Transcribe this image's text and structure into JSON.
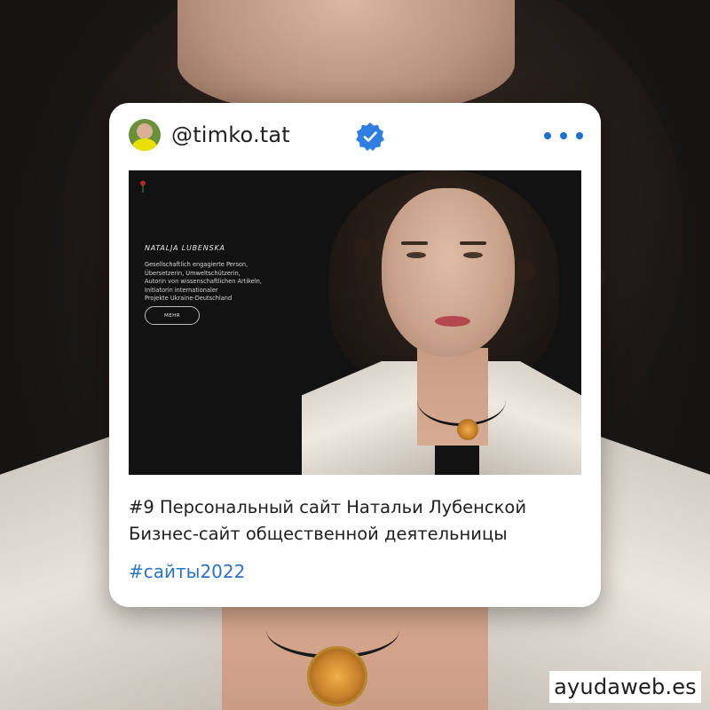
{
  "post": {
    "username": "@timko.tat",
    "verified": true,
    "more_icon": "more-dots-icon",
    "caption_line1": "#9 Персональный сайт Натальи Лубенской",
    "caption_line2": "Бизнес-сайт общественной деятельницы",
    "hashtag": "#сайты2022"
  },
  "preview": {
    "name": "NATALJA LUBENSKA",
    "description_lines": [
      "Gesellschaftlich engagierte Person,",
      "Übersetzerin, Umweltschützerin,",
      "Autorin von wissenschaftlichen Artikeln,",
      "Initiatorin internationaler",
      "Projekte Ukraine-Deutschland"
    ],
    "button": "MEHR"
  },
  "watermark": "ayudaweb.es",
  "colors": {
    "accent_blue": "#1f6fd0",
    "hashtag_blue": "#2b73c4",
    "card_background": "#ffffff",
    "preview_background": "#121212"
  }
}
